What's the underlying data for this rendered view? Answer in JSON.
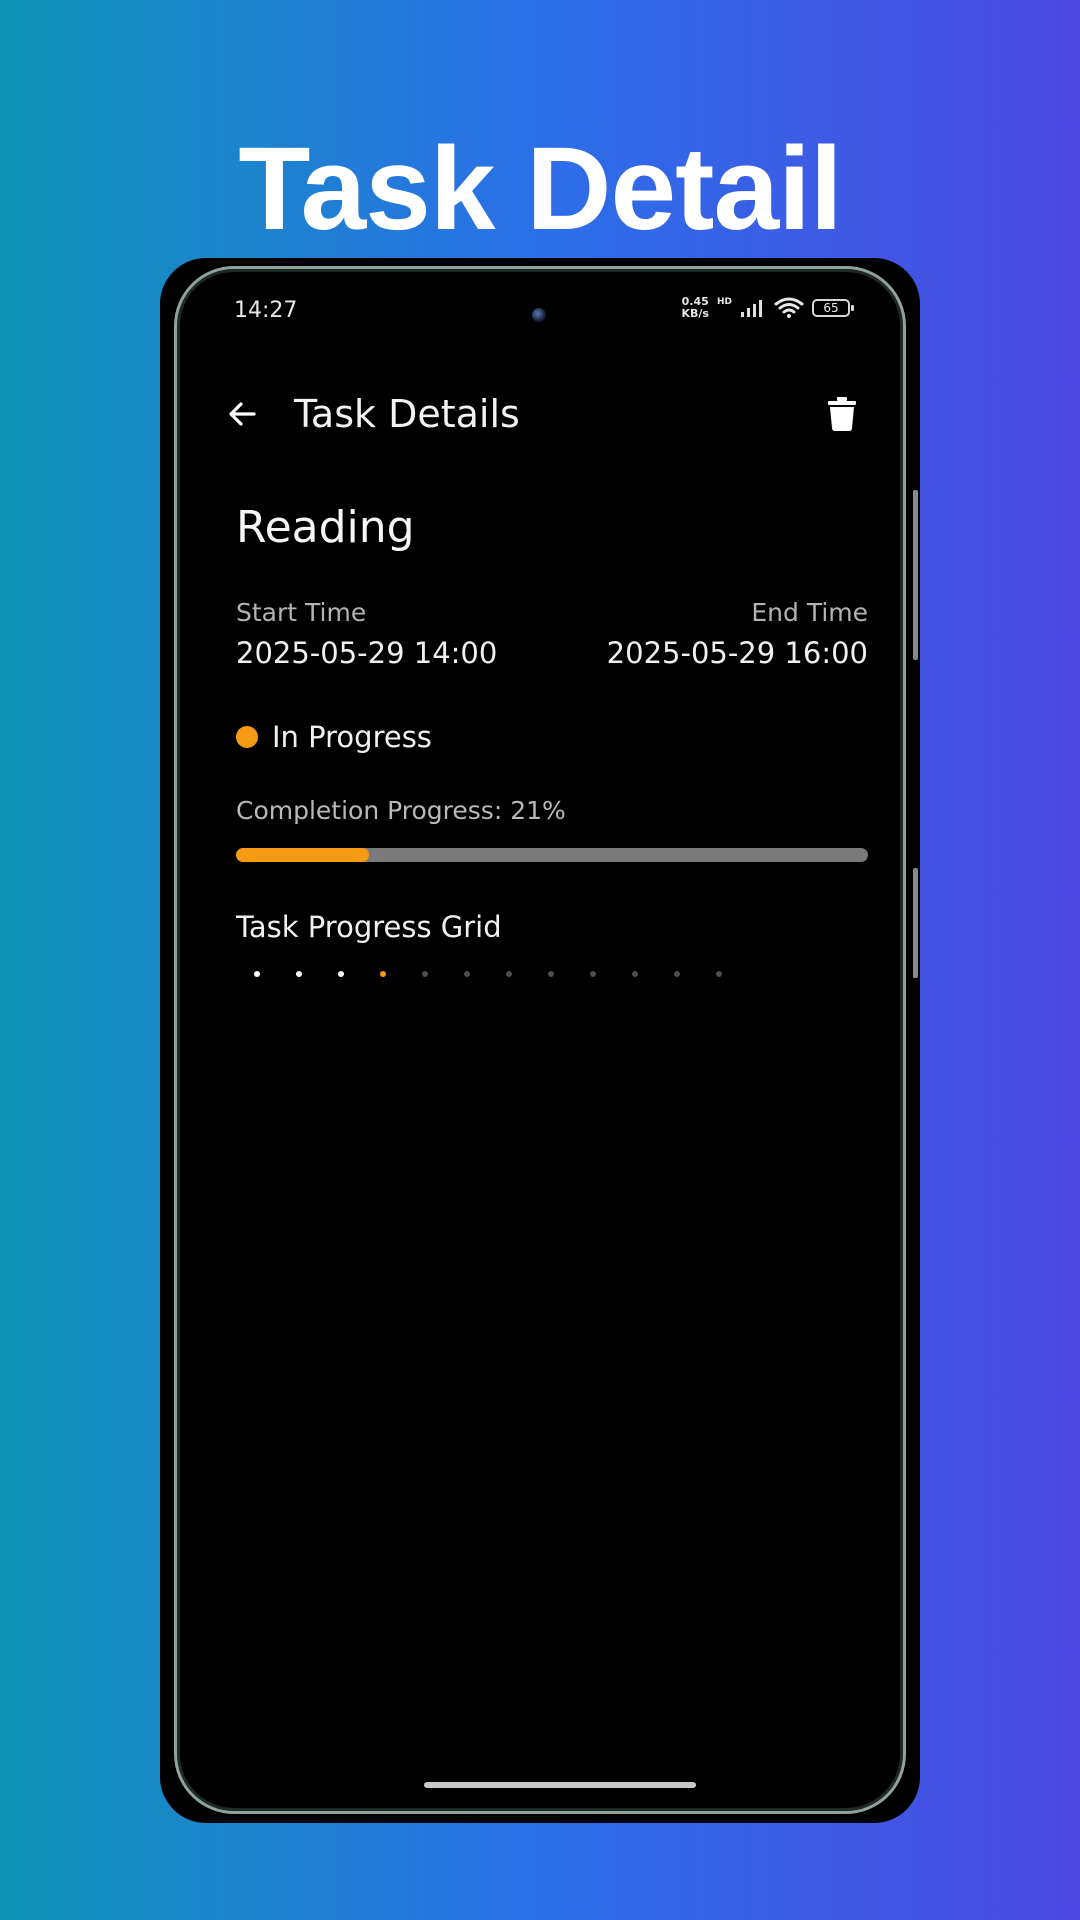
{
  "promo": {
    "title": "Task Detail"
  },
  "status_bar": {
    "time": "14:27",
    "net_speed_value": "0.45",
    "net_speed_unit": "KB/s",
    "hd_label": "HD",
    "battery": "65"
  },
  "app_bar": {
    "title": "Task Details",
    "back_icon": "arrow-left-icon",
    "delete_icon": "trash-icon"
  },
  "task": {
    "name": "Reading",
    "start_label": "Start Time",
    "start_value": "2025-05-29 14:00",
    "end_label": "End Time",
    "end_value": "2025-05-29 16:00",
    "status": "In Progress",
    "progress_label": "Completion Progress: 21%",
    "progress_percent": 21
  },
  "grid": {
    "title": "Task Progress Grid",
    "total_cells": 12,
    "completed_cells": 3,
    "current_cell": 4
  },
  "colors": {
    "accent": "#f59a12",
    "done_dot": "#ffffff",
    "pending_dot": "#4d4d4d",
    "track": "#7a7a7a"
  }
}
